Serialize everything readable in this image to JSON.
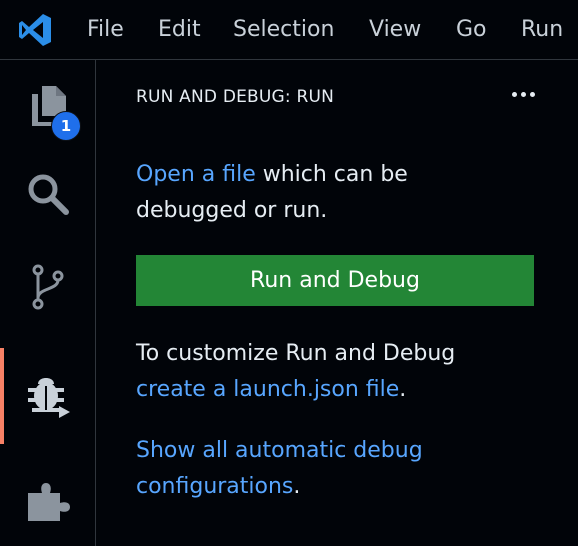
{
  "menu": {
    "items": [
      "File",
      "Edit",
      "Selection",
      "View",
      "Go",
      "Run"
    ]
  },
  "activity_bar": {
    "explorer_badge": "1",
    "active_indicator_color": "#f78166",
    "icons": [
      "files-icon",
      "search-icon",
      "source-control-icon",
      "run-debug-icon",
      "extensions-icon"
    ]
  },
  "sidebar": {
    "title": "RUN AND DEBUG: RUN",
    "open_file_link": "Open a file",
    "open_file_text": " which can be debugged or run.",
    "run_button": "Run and Debug",
    "customize_text": "To customize Run and Debug",
    "launch_link": "create a launch.json file",
    "launch_suffix": ".",
    "show_all_link": "Show all automatic debug configurations",
    "show_all_suffix": "."
  },
  "colors": {
    "background": "#010409",
    "link": "#58a6ff",
    "button": "#238636",
    "badge": "#1f6feb",
    "logo": "#2b8ee8"
  }
}
